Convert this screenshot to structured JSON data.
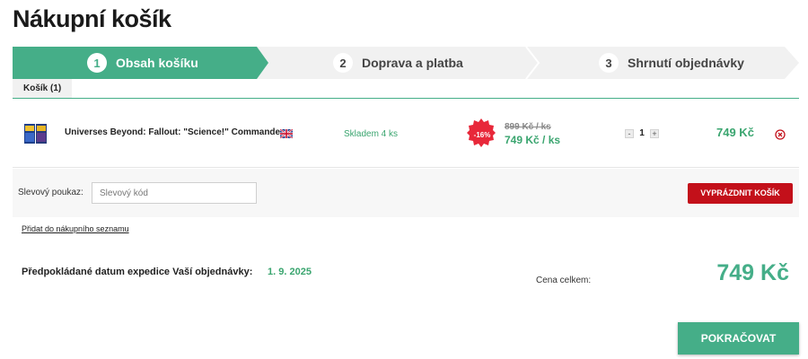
{
  "page": {
    "title": "Nákupní košík"
  },
  "steps": [
    {
      "number": "1",
      "label": "Obsah košíku",
      "active": true
    },
    {
      "number": "2",
      "label": "Doprava a platba",
      "active": false
    },
    {
      "number": "3",
      "label": "Shrnutí objednávky",
      "active": false
    }
  ],
  "tab": {
    "label": "Košík (1)"
  },
  "item": {
    "name": "Universes Beyond: Fallout: \"Science!\" Commander...",
    "language_icon": "uk-flag-icon",
    "stock": "Skladem 4 ks",
    "discount": "-16%",
    "old_price": "899 Kč / ks",
    "new_price": "749 Kč / ks",
    "qty_minus": "-",
    "quantity": "1",
    "qty_plus": "+",
    "total": "749 Kč"
  },
  "coupon": {
    "label": "Slevový poukaz:",
    "placeholder": "Slevový kód",
    "clear_button": "VYPRÁZDNIT KOŠÍK"
  },
  "wishlist_link": "Přidat do nákupního seznamu",
  "expedition": {
    "label": "Předpokládané datum expedice Vaší objednávky:",
    "date": "1. 9. 2025"
  },
  "summary": {
    "total_label": "Cena celkem:",
    "total_value": "749 Kč"
  },
  "continue_button": "POKRAČOVAT",
  "colors": {
    "accent": "#45ae88",
    "danger": "#c3101a",
    "step_inactive": "#f1f1f1",
    "badge": "#e8283a"
  }
}
